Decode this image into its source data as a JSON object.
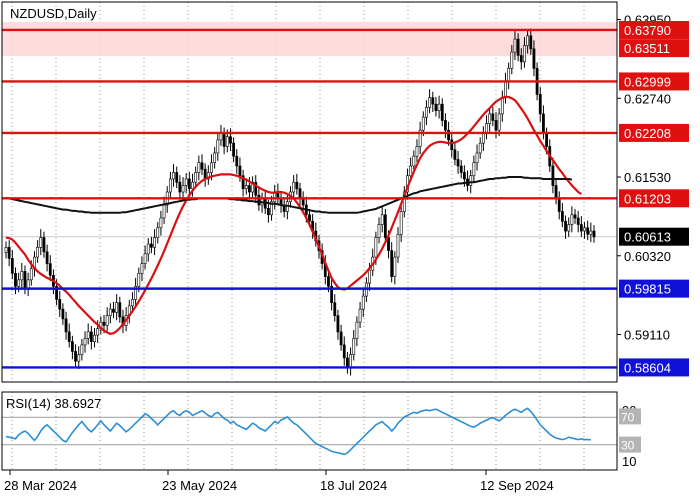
{
  "chart_data": {
    "type": "candlestick",
    "title": "NZDUSD,Daily",
    "price_axis_ticks": [
      "0.63950",
      "0.62740",
      "0.61530",
      "0.60320",
      "0.59110"
    ],
    "ylim": [
      0.5838,
      0.6422
    ],
    "x_tick_labels": [
      "28 Mar 2024",
      "23 May 2024",
      "18 Jul 2024",
      "12 Sep 2024"
    ],
    "last_price": "0.60613",
    "resistance_levels": [
      {
        "value": 0.6379,
        "label": "0.63790"
      },
      {
        "value": 0.63511,
        "label": "0.63511"
      },
      {
        "value": 0.62999,
        "label": "0.62999"
      },
      {
        "value": 0.62208,
        "label": "0.62208"
      },
      {
        "value": 0.61203,
        "label": "0.61203"
      }
    ],
    "support_levels": [
      {
        "value": 0.59815,
        "label": "0.59815"
      },
      {
        "value": 0.58604,
        "label": "0.58604"
      }
    ],
    "resistance_zone": [
      0.63511,
      0.6379
    ],
    "close_series": [
      0.6045,
      0.6028,
      0.6005,
      0.5985,
      0.5995,
      0.6008,
      0.5982,
      0.5995,
      0.6012,
      0.603,
      0.6045,
      0.606,
      0.6038,
      0.602,
      0.6002,
      0.5985,
      0.5965,
      0.595,
      0.5935,
      0.5915,
      0.59,
      0.5885,
      0.587,
      0.588,
      0.5895,
      0.5905,
      0.5915,
      0.59,
      0.591,
      0.592,
      0.593,
      0.5925,
      0.594,
      0.595,
      0.5945,
      0.596,
      0.5938,
      0.5925,
      0.594,
      0.5955,
      0.5965,
      0.5985,
      0.6005,
      0.602,
      0.6035,
      0.605,
      0.6045,
      0.606,
      0.6075,
      0.609,
      0.611,
      0.613,
      0.615,
      0.616,
      0.6145,
      0.613,
      0.614,
      0.615,
      0.6135,
      0.6145,
      0.616,
      0.6175,
      0.6165,
      0.615,
      0.616,
      0.6175,
      0.619,
      0.621,
      0.622,
      0.62,
      0.6215,
      0.6205,
      0.6185,
      0.617,
      0.6155,
      0.6135,
      0.614,
      0.613,
      0.6145,
      0.6125,
      0.611,
      0.612,
      0.6105,
      0.6095,
      0.6115,
      0.613,
      0.612,
      0.611,
      0.61,
      0.6115,
      0.613,
      0.6145,
      0.6135,
      0.612,
      0.611,
      0.6095,
      0.6085,
      0.607,
      0.6055,
      0.604,
      0.602,
      0.6,
      0.5985,
      0.596,
      0.594,
      0.5915,
      0.5895,
      0.5875,
      0.586,
      0.588,
      0.5905,
      0.593,
      0.595,
      0.597,
      0.599,
      0.601,
      0.603,
      0.606,
      0.608,
      0.6095,
      0.606,
      0.604,
      0.6,
      0.603,
      0.6065,
      0.61,
      0.613,
      0.6155,
      0.617,
      0.6185,
      0.62,
      0.6225,
      0.6245,
      0.626,
      0.6275,
      0.6265,
      0.6255,
      0.6265,
      0.624,
      0.6225,
      0.621,
      0.6195,
      0.618,
      0.617,
      0.616,
      0.615,
      0.614,
      0.6155,
      0.6175,
      0.619,
      0.6205,
      0.622,
      0.6235,
      0.625,
      0.624,
      0.6225,
      0.625,
      0.6275,
      0.63,
      0.632,
      0.6345,
      0.6365,
      0.634,
      0.633,
      0.6355,
      0.637,
      0.635,
      0.632,
      0.628,
      0.625,
      0.622,
      0.62,
      0.617,
      0.614,
      0.612,
      0.61,
      0.6085,
      0.607,
      0.608,
      0.6095,
      0.609,
      0.608,
      0.607,
      0.6075,
      0.6065,
      0.607,
      0.6061
    ],
    "moving_averages": [
      {
        "color": "#d81010",
        "values": [
          0.606,
          0.6059,
          0.6057,
          0.6052,
          0.6046,
          0.604,
          0.6034,
          0.6026,
          0.6019,
          0.6013,
          0.6008,
          0.6004,
          0.6001,
          0.5998,
          0.5996,
          0.5993,
          0.599,
          0.5986,
          0.5981,
          0.5977,
          0.5972,
          0.5966,
          0.5961,
          0.5955,
          0.595,
          0.5945,
          0.594,
          0.5935,
          0.593,
          0.5926,
          0.5921,
          0.5917,
          0.5914,
          0.5912,
          0.5913,
          0.5916,
          0.5921,
          0.5927,
          0.5933,
          0.594,
          0.5947,
          0.5954,
          0.5962,
          0.597,
          0.5979,
          0.5988,
          0.5997,
          0.6007,
          0.6017,
          0.6028,
          0.6039,
          0.6051,
          0.6063,
          0.6075,
          0.6087,
          0.6098,
          0.6108,
          0.6117,
          0.6125,
          0.6132,
          0.6138,
          0.6143,
          0.6147,
          0.615,
          0.6152,
          0.6154,
          0.6155,
          0.6156,
          0.6157,
          0.6157,
          0.6157,
          0.6157,
          0.6156,
          0.6155,
          0.6153,
          0.6151,
          0.6149,
          0.6146,
          0.6143,
          0.614,
          0.6137,
          0.6134,
          0.6132,
          0.613,
          0.6129,
          0.6129,
          0.613,
          0.613,
          0.6129,
          0.6127,
          0.6124,
          0.612,
          0.6114,
          0.6107,
          0.6099,
          0.609,
          0.608,
          0.6069,
          0.6058,
          0.6046,
          0.6034,
          0.6021,
          0.6009,
          0.5998,
          0.599,
          0.5984,
          0.5981,
          0.598,
          0.5982,
          0.5986,
          0.599,
          0.5994,
          0.5998,
          0.6002,
          0.6007,
          0.6013,
          0.6019,
          0.6026,
          0.6034,
          0.6043,
          0.6053,
          0.6063,
          0.6075,
          0.6087,
          0.6099,
          0.6112,
          0.6124,
          0.6137,
          0.6149,
          0.6161,
          0.6172,
          0.6182,
          0.619,
          0.6196,
          0.6201,
          0.6204,
          0.6206,
          0.6207,
          0.6207,
          0.6206,
          0.6205,
          0.6205,
          0.6206,
          0.6208,
          0.6211,
          0.6215,
          0.622,
          0.6225,
          0.6231,
          0.6237,
          0.6243,
          0.6249,
          0.6254,
          0.6259,
          0.6264,
          0.6269,
          0.6272,
          0.6275,
          0.6276,
          0.6276,
          0.6274,
          0.6271,
          0.6265,
          0.6258,
          0.6251,
          0.6243,
          0.6234,
          0.6225,
          0.6217,
          0.6208,
          0.6201,
          0.6193,
          0.6186,
          0.6179,
          0.6172,
          0.6165,
          0.6159,
          0.6152,
          0.6146,
          0.614,
          0.6135,
          0.613,
          0.6127
        ]
      },
      {
        "color": "#111111",
        "values": [
          0.6121,
          0.612,
          0.6119,
          0.6118,
          0.6117,
          0.6116,
          0.6115,
          0.6114,
          0.6113,
          0.6112,
          0.6111,
          0.611,
          0.6109,
          0.6108,
          0.6107,
          0.6106,
          0.6105,
          0.6104,
          0.6103,
          0.6103,
          0.6102,
          0.6101,
          0.6101,
          0.61,
          0.61,
          0.6099,
          0.6099,
          0.6098,
          0.6098,
          0.6098,
          0.6098,
          0.6098,
          0.6098,
          0.6098,
          0.6098,
          0.6098,
          0.6098,
          0.6099,
          0.6099,
          0.61,
          0.6101,
          0.6102,
          0.6103,
          0.6104,
          0.6105,
          0.6106,
          0.6107,
          0.6108,
          0.6109,
          0.611,
          0.6111,
          0.6112,
          0.6113,
          0.6114,
          0.6115,
          0.6116,
          0.6117,
          0.6118,
          0.6118,
          0.6119,
          0.6119,
          0.612,
          0.612,
          0.612,
          0.612,
          0.612,
          0.612,
          0.612,
          0.612,
          0.612,
          0.612,
          0.6119,
          0.6119,
          0.6118,
          0.6118,
          0.6117,
          0.6117,
          0.6116,
          0.6116,
          0.6115,
          0.6115,
          0.6114,
          0.6114,
          0.6113,
          0.6112,
          0.6112,
          0.6111,
          0.611,
          0.6109,
          0.6109,
          0.6108,
          0.6107,
          0.6106,
          0.6105,
          0.6104,
          0.6103,
          0.6102,
          0.6101,
          0.61,
          0.61,
          0.6099,
          0.6099,
          0.6098,
          0.6098,
          0.6098,
          0.6098,
          0.6098,
          0.6098,
          0.6098,
          0.6098,
          0.6098,
          0.6098,
          0.6099,
          0.61,
          0.6101,
          0.6102,
          0.6103,
          0.6104,
          0.6106,
          0.6108,
          0.611,
          0.6112,
          0.6114,
          0.6116,
          0.6118,
          0.612,
          0.6122,
          0.6124,
          0.6126,
          0.6128,
          0.6129,
          0.6131,
          0.6132,
          0.6133,
          0.6134,
          0.6135,
          0.6136,
          0.6137,
          0.6138,
          0.6139,
          0.614,
          0.6141,
          0.6142,
          0.6143,
          0.6143,
          0.6144,
          0.6144,
          0.6145,
          0.6145,
          0.6146,
          0.6147,
          0.6148,
          0.6149,
          0.615,
          0.615,
          0.6151,
          0.6151,
          0.6152,
          0.6152,
          0.6153,
          0.6153,
          0.6153,
          0.6153,
          0.6153,
          0.6152,
          0.6152,
          0.6151,
          0.6151,
          0.6151,
          0.6151,
          0.615,
          0.615,
          0.615,
          0.615,
          0.615,
          0.615,
          0.615,
          0.615,
          0.615,
          0.6149
        ]
      }
    ],
    "rsi": {
      "label": "RSI(14) 38.6927",
      "levels": [
        "70",
        "30",
        "10"
      ],
      "panel_ticks": [
        "90"
      ],
      "ylim": [
        0,
        100
      ],
      "values": [
        43,
        42,
        41,
        40,
        45,
        48,
        50,
        47,
        42,
        38,
        43,
        50,
        55,
        58,
        54,
        50,
        46,
        42,
        38,
        36,
        42,
        48,
        53,
        58,
        62,
        57,
        52,
        49,
        53,
        58,
        63,
        58,
        54,
        50,
        55,
        60,
        57,
        53,
        49,
        52,
        56,
        60,
        64,
        68,
        72,
        70,
        66,
        62,
        58,
        62,
        66,
        70,
        74,
        76,
        72,
        70,
        74,
        76,
        74,
        70,
        72,
        74,
        76,
        73,
        70,
        68,
        72,
        74,
        70,
        66,
        64,
        60,
        62,
        58,
        56,
        54,
        52,
        56,
        60,
        58,
        54,
        52,
        50,
        54,
        58,
        62,
        60,
        64,
        66,
        68,
        64,
        60,
        58,
        54,
        50,
        46,
        42,
        38,
        34,
        32,
        30,
        28,
        26,
        24,
        23,
        22,
        21,
        20,
        22,
        26,
        30,
        34,
        38,
        42,
        46,
        50,
        54,
        58,
        60,
        62,
        58,
        55,
        50,
        54,
        60,
        64,
        68,
        70,
        72,
        74,
        73,
        75,
        76,
        77,
        76,
        77,
        78,
        76,
        74,
        72,
        70,
        68,
        66,
        64,
        62,
        60,
        58,
        56,
        55,
        57,
        60,
        62,
        64,
        66,
        67,
        65,
        63,
        66,
        70,
        73,
        76,
        78,
        76,
        74,
        77,
        79,
        75,
        70,
        64,
        58,
        54,
        50,
        46,
        43,
        41,
        40,
        39,
        40,
        42,
        41,
        40,
        39,
        40,
        39,
        39,
        38.7
      ]
    },
    "candle_count": 185
  },
  "page": {
    "symbol_label": "NZDUSD,Daily",
    "rsi_label": "RSI(14) 38.6927"
  }
}
